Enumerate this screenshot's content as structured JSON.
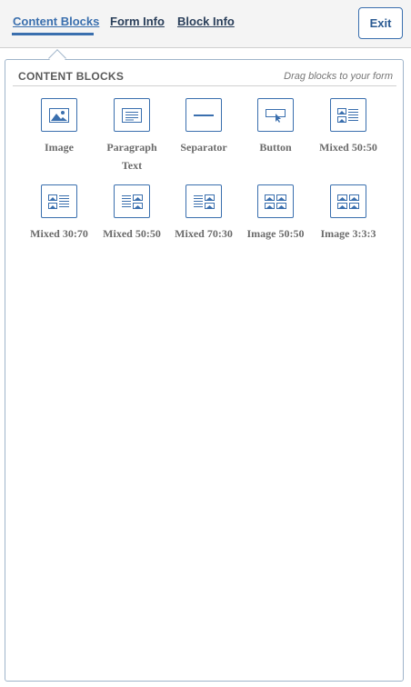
{
  "tabs": [
    {
      "label": "Content Blocks",
      "active": true
    },
    {
      "label": "Form Info",
      "active": false
    },
    {
      "label": "Block Info",
      "active": false
    }
  ],
  "exit_label": "Exit",
  "panel": {
    "title": "CONTENT BLOCKS",
    "hint": "Drag blocks to your form"
  },
  "blocks": [
    {
      "label": "Image",
      "icon": "image-icon"
    },
    {
      "label": "Paragraph Text",
      "icon": "paragraph-icon"
    },
    {
      "label": "Separator",
      "icon": "separator-icon"
    },
    {
      "label": "Button",
      "icon": "button-icon"
    },
    {
      "label": "Mixed 50:50",
      "icon": "mixed-layout-icon"
    },
    {
      "label": "Mixed 30:70",
      "icon": "mixed-layout-icon"
    },
    {
      "label": "Mixed 50:50",
      "icon": "mixed-layout-icon"
    },
    {
      "label": "Mixed 70:30",
      "icon": "mixed-layout-icon"
    },
    {
      "label": "Image 50:50",
      "icon": "image-columns-icon"
    },
    {
      "label": "Image 3:3:3",
      "icon": "image-columns-icon"
    }
  ],
  "colors": {
    "accent": "#3a6fae",
    "tab_text": "#2a3f5a",
    "label_text": "#6b6b6b"
  }
}
